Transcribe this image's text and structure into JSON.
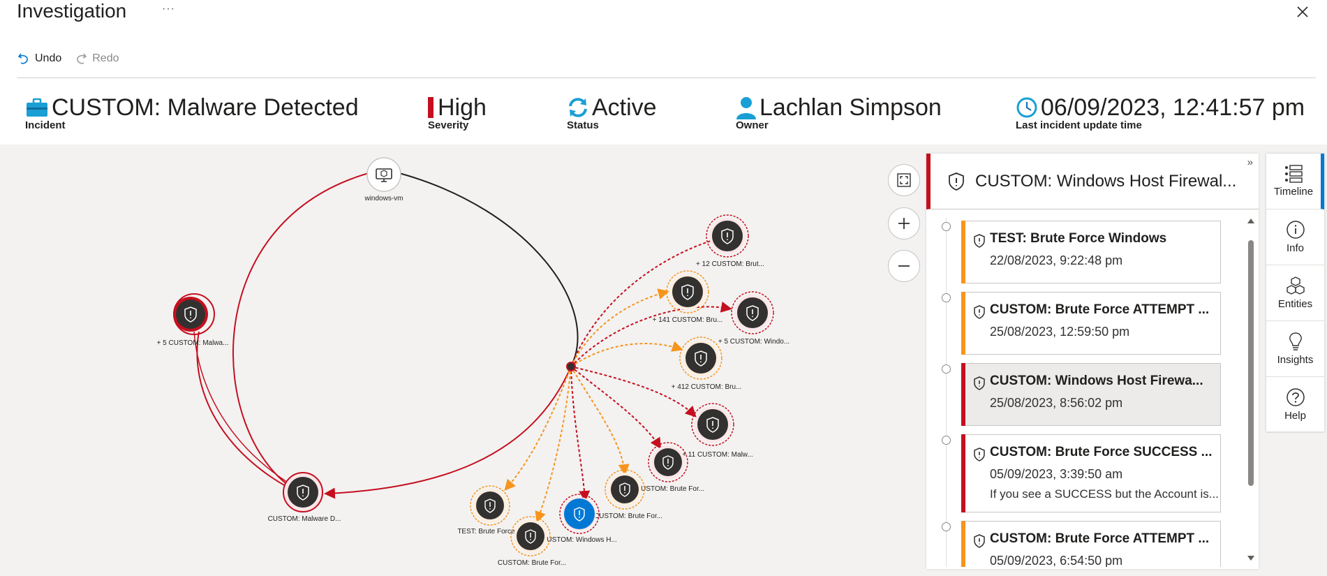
{
  "window": {
    "title": "Investigation",
    "more_label": "···"
  },
  "toolbar": {
    "undo_label": "Undo",
    "redo_label": "Redo"
  },
  "summary": {
    "incident": {
      "value": "CUSTOM: Malware Detected",
      "label": "Incident"
    },
    "severity": {
      "value": "High",
      "label": "Severity",
      "color": "#c50f1f"
    },
    "status": {
      "value": "Active",
      "label": "Status"
    },
    "owner": {
      "value": "Lachlan Simpson",
      "label": "Owner"
    },
    "updated": {
      "value": "06/09/2023, 12:41:57 pm",
      "label": "Last incident update time"
    }
  },
  "graph": {
    "nodes": {
      "vm": "windows-vm",
      "malware_group": "+ 5 CUSTOM: Malwa...",
      "incident_center": "CUSTOM: Malware D...",
      "n1": "+ 12 CUSTOM: Brut...",
      "n2": "+ 141 CUSTOM: Bru...",
      "n3": "+ 5 CUSTOM: Windo...",
      "n4": "+ 412 CUSTOM: Bru...",
      "n5": "+ 11 CUSTOM: Malw...",
      "n6": "CUSTOM: Brute For...",
      "n7": "CUSTOM: Brute For...",
      "n8": "CUSTOM: Windows H...",
      "n9": "TEST: Brute Force ...",
      "n10": "CUSTOM: Brute For..."
    }
  },
  "colors": {
    "high": "#c50f1f",
    "medium": "#f7941d",
    "selected": "#0078d4"
  },
  "panel": {
    "title": "CUSTOM: Windows Host Firewal...",
    "collapse_label": "»",
    "cards": [
      {
        "title": "TEST: Brute Force Windows",
        "date": "22/08/2023, 9:22:48 pm",
        "severity": "medium"
      },
      {
        "title": "CUSTOM: Brute Force ATTEMPT ...",
        "date": "25/08/2023, 12:59:50 pm",
        "severity": "medium"
      },
      {
        "title": "CUSTOM: Windows Host Firewa...",
        "date": "25/08/2023, 8:56:02 pm",
        "severity": "high",
        "selected": true
      },
      {
        "title": "CUSTOM: Brute Force SUCCESS ...",
        "date": "05/09/2023, 3:39:50 am",
        "description": "If you see a SUCCESS but the Account is...",
        "severity": "high"
      },
      {
        "title": "CUSTOM: Brute Force ATTEMPT ...",
        "date": "05/09/2023, 6:54:50 pm",
        "severity": "medium"
      }
    ]
  },
  "sidetabs": [
    {
      "label": "Timeline",
      "icon": "timeline-icon",
      "active": true
    },
    {
      "label": "Info",
      "icon": "info-icon"
    },
    {
      "label": "Entities",
      "icon": "entities-icon"
    },
    {
      "label": "Insights",
      "icon": "insights-icon"
    },
    {
      "label": "Help",
      "icon": "help-icon"
    }
  ]
}
